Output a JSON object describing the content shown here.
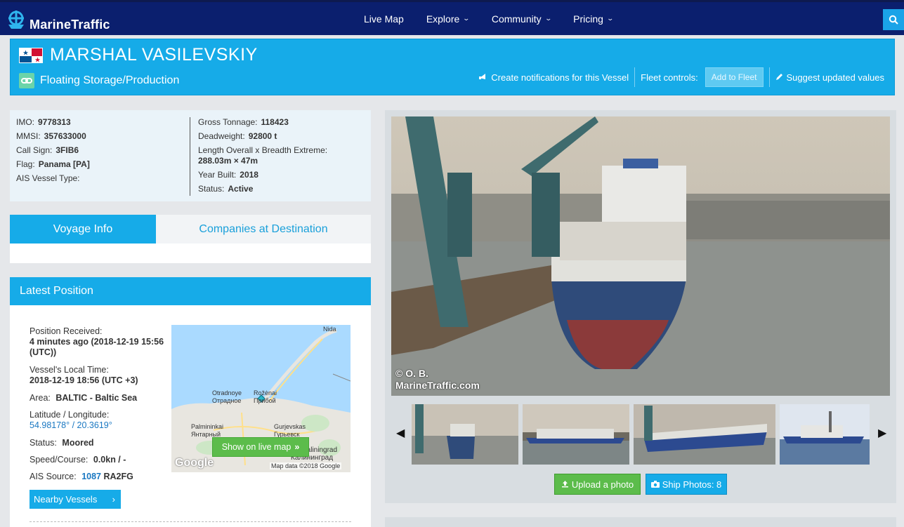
{
  "header": {
    "brand": "MarineTraffic",
    "nav": [
      "Live Map",
      "Explore",
      "Community",
      "Pricing"
    ]
  },
  "vessel": {
    "name": "MARSHAL VASILEVSKIY",
    "type": "Floating Storage/Production",
    "actions": {
      "notify": "Create notifications for this Vessel",
      "fleet_controls": "Fleet controls:",
      "add_to_fleet": "Add to Fleet",
      "suggest": "Suggest updated values"
    }
  },
  "details": {
    "left": [
      {
        "label": "IMO:",
        "value": "9778313"
      },
      {
        "label": "MMSI:",
        "value": "357633000"
      },
      {
        "label": "Call Sign:",
        "value": "3FIB6"
      },
      {
        "label": "Flag:",
        "value": "Panama [PA]"
      },
      {
        "label": "AIS Vessel Type:",
        "value": ""
      }
    ],
    "right": {
      "gross_label": "Gross Tonnage:",
      "gross": "118423",
      "dwt_label": "Deadweight:",
      "dwt": "92800 t",
      "loa_label": "Length Overall x Breadth Extreme:",
      "loa": "288.03m × 47m",
      "built_label": "Year Built:",
      "built": "2018",
      "status_label": "Status:",
      "status": "Active"
    }
  },
  "tabs": {
    "voyage": "Voyage Info",
    "companies": "Companies at Destination"
  },
  "latest_position": {
    "title": "Latest Position",
    "received_label": "Position Received:",
    "received": "4 minutes ago (2018-12-19 15:56 (UTC))",
    "local_label": "Vessel's Local Time:",
    "local": "2018-12-19 18:56 (UTC +3)",
    "area_label": "Area:",
    "area": "BALTIC - Baltic Sea",
    "latlon_label": "Latitude / Longitude:",
    "latlon": "54.98178° / 20.3619°",
    "status_label": "Status:",
    "status": "Moored",
    "speed_label": "Speed/Course:",
    "speed": "0.0kn / -",
    "ais_label": "AIS Source:",
    "ais_id": "1087",
    "ais_call": "RA2FG",
    "nearby": "Nearby Vessels",
    "map": {
      "show_btn": "Show on live map",
      "labels": [
        "Nida",
        "Otradnoye",
        "Отрадное",
        "Rožėnai",
        "Прибой",
        "Palmininkai",
        "Янтарный",
        "Gurjevskas",
        "Гурьевск",
        "Kaliningrad",
        "Калининград"
      ],
      "google": "Google",
      "mapdata": "Map data ©2018 Google"
    }
  },
  "photos": {
    "credit_1": "© O. B.",
    "credit_2": "MarineTraffic.com",
    "upload": "Upload a photo",
    "ship_photos": "Ship Photos: 8"
  }
}
